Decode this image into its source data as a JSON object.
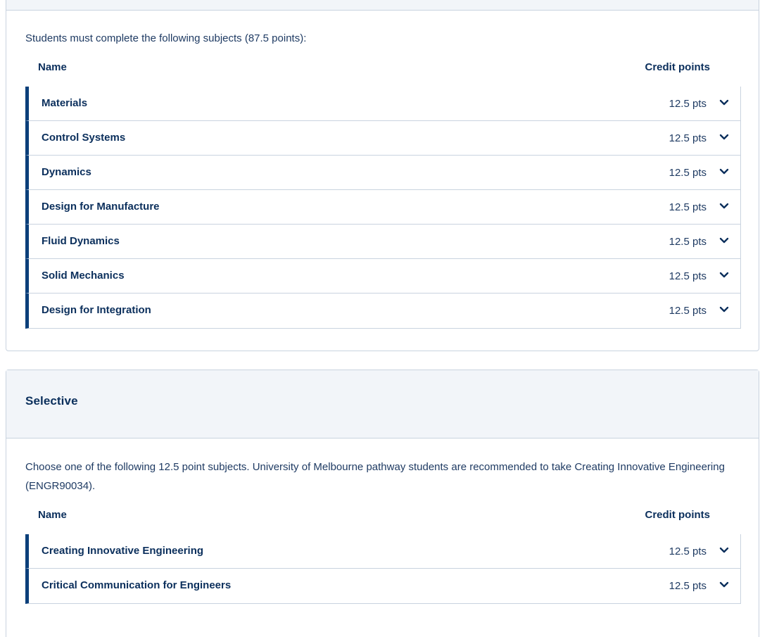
{
  "core": {
    "intro": "Students must complete the following subjects (87.5 points):",
    "col_name": "Name",
    "col_credit": "Credit points",
    "subjects": [
      {
        "name": "Materials",
        "points": "12.5 pts"
      },
      {
        "name": "Control Systems",
        "points": "12.5 pts"
      },
      {
        "name": "Dynamics",
        "points": "12.5 pts"
      },
      {
        "name": "Design for Manufacture",
        "points": "12.5 pts"
      },
      {
        "name": "Fluid Dynamics",
        "points": "12.5 pts"
      },
      {
        "name": "Solid Mechanics",
        "points": "12.5 pts"
      },
      {
        "name": "Design for Integration",
        "points": "12.5 pts"
      }
    ]
  },
  "selective": {
    "title": "Selective",
    "intro": "Choose one of the following 12.5 point subjects. University of Melbourne pathway students are recommended to take Creating Innovative Engineering (ENGR90034).",
    "col_name": "Name",
    "col_credit": "Credit points",
    "subjects": [
      {
        "name": "Creating Innovative Engineering",
        "points": "12.5 pts"
      },
      {
        "name": "Critical Communication for Engineers",
        "points": "12.5 pts"
      }
    ]
  },
  "icons": {
    "expand": "chevron-down-icon"
  },
  "colors": {
    "accent": "#0b3f7a",
    "text": "#0b2f5c",
    "header_bg": "#f2f5f9",
    "border": "#c9d3df"
  }
}
